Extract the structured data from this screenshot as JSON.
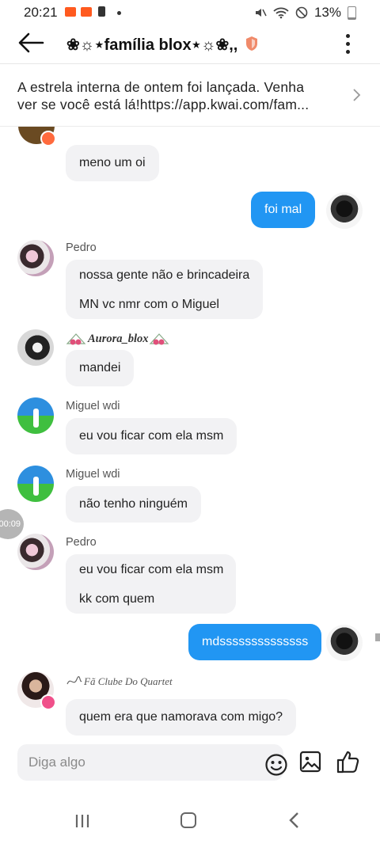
{
  "status_bar": {
    "time": "20:21",
    "battery": "13%"
  },
  "header": {
    "title": "❀☼⋆família blox⋆☼❀,,"
  },
  "banner": {
    "line1": "A estrela interna de ontem foi lançada. Venha",
    "line2": "ver se você está lá!https://app.kwai.com/fam..."
  },
  "messages": {
    "m0": {
      "text": "meno um oi"
    },
    "m1": {
      "text": "foi mal"
    },
    "m2": {
      "sender": "Pedro",
      "lines": [
        "nossa gente não e brincadeira",
        "MN vc nmr com o Miguel"
      ]
    },
    "m3": {
      "sender": "Aurora_blox",
      "text": "mandei"
    },
    "m4": {
      "sender": "Miguel wdi",
      "text": "eu vou ficar com ela msm"
    },
    "m5": {
      "sender": "Miguel wdi",
      "text": "não tenho ninguém"
    },
    "m6": {
      "sender": "Pedro",
      "lines": [
        "eu vou ficar com ela msm",
        "kk com quem"
      ]
    },
    "m7": {
      "text": "mdssssssssssssss"
    },
    "m8": {
      "sender": "Fã Clube Do Quartet",
      "text": "quem era que namorava com migo?"
    }
  },
  "overlay": {
    "timer": "00:09"
  },
  "composer": {
    "placeholder": "Diga algo"
  },
  "colors": {
    "accent": "#2196f3",
    "bubble_bg": "#f2f2f4"
  }
}
